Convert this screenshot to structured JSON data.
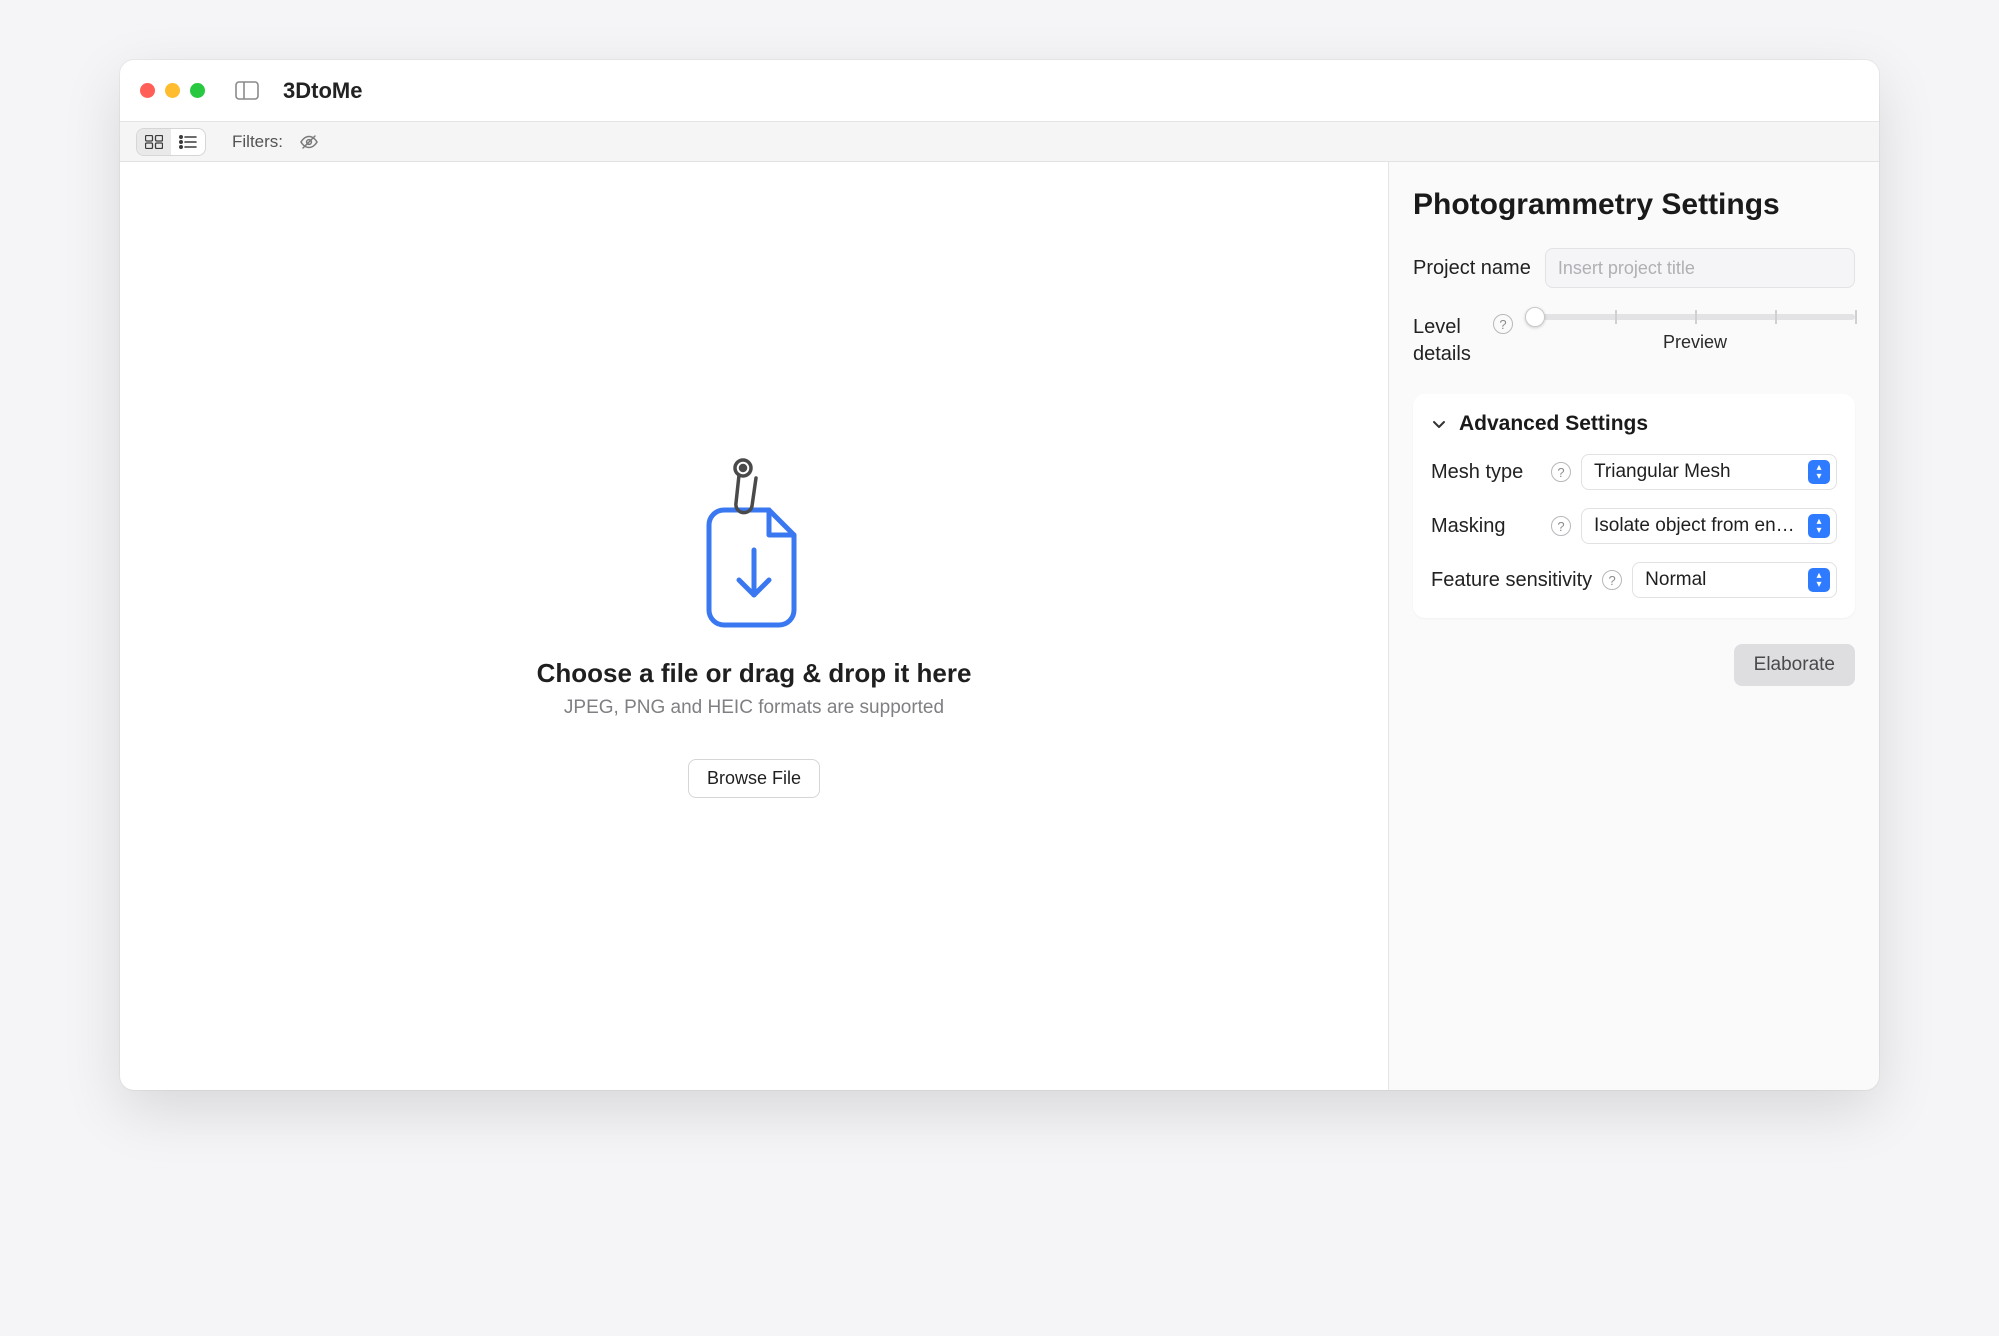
{
  "titlebar": {
    "app_name": "3DtoMe"
  },
  "subtoolbar": {
    "filters_label": "Filters:"
  },
  "drop": {
    "title": "Choose a file or drag & drop it here",
    "subtitle": "JPEG, PNG and HEIC formats are supported",
    "browse_label": "Browse File"
  },
  "panel": {
    "title": "Photogrammetry Settings",
    "project_name_label": "Project name",
    "project_name_placeholder": "Insert project title",
    "level_label": "Level details",
    "level_value_caption": "Preview",
    "advanced": {
      "header": "Advanced Settings",
      "mesh_type_label": "Mesh type",
      "mesh_type_value": "Triangular Mesh",
      "masking_label": "Masking",
      "masking_value": "Isolate object from environ…",
      "feature_label": "Feature sensitivity",
      "feature_value": "Normal"
    },
    "elaborate_label": "Elaborate"
  }
}
